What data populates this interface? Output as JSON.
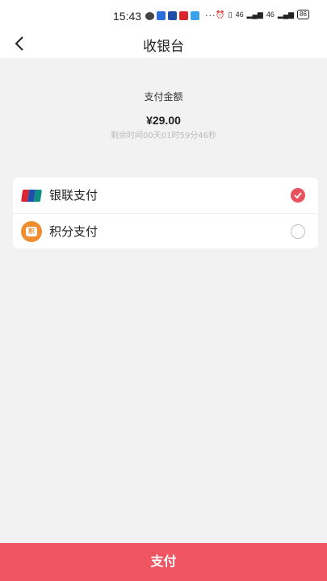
{
  "status_bar": {
    "time": "15:43",
    "dots": "···",
    "signal_left": "46",
    "signal_right": "46",
    "battery": "86"
  },
  "header": {
    "title": "收银台"
  },
  "payment": {
    "amount_label": "支付金额",
    "amount": "¥29.00",
    "remaining_time": "剩余时间00天01时59分46秒"
  },
  "methods": [
    {
      "label": "银联支付",
      "icon": "unionpay-icon",
      "selected": true
    },
    {
      "label": "积分支付",
      "icon": "points-icon",
      "selected": false
    }
  ],
  "footer": {
    "pay_label": "支付"
  },
  "colors": {
    "accent": "#ef5560",
    "check": "#e8515e",
    "points_icon": "#ef8d2f",
    "background": "#f2f2f2"
  }
}
